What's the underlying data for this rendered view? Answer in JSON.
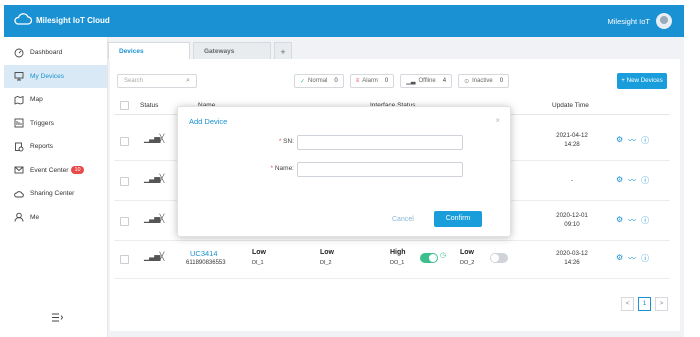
{
  "app": {
    "title": "Milesight IoT Cloud",
    "user": "Milesight IoT"
  },
  "sidebar": {
    "items": [
      {
        "label": "Dashboard",
        "icon": "dashboard-icon"
      },
      {
        "label": "My Devices",
        "icon": "devices-icon",
        "active": true
      },
      {
        "label": "Map",
        "icon": "map-icon"
      },
      {
        "label": "Triggers",
        "icon": "triggers-icon"
      },
      {
        "label": "Reports",
        "icon": "reports-icon"
      },
      {
        "label": "Event Center",
        "icon": "mail-icon",
        "badge": "10"
      },
      {
        "label": "Sharing Center",
        "icon": "cloud-share-icon"
      },
      {
        "label": "Me",
        "icon": "user-icon"
      }
    ]
  },
  "tabs": [
    {
      "label": "Devices"
    },
    {
      "label": "Gateways"
    },
    {
      "label": "+"
    }
  ],
  "toolbar": {
    "search_placeholder": "Search",
    "filters": [
      {
        "label": "Normal",
        "count": "0"
      },
      {
        "label": "Alarm",
        "count": "0"
      },
      {
        "label": "Offline",
        "count": "4"
      },
      {
        "label": "Inactive",
        "count": "0"
      }
    ],
    "new_button": "+ New Devices"
  },
  "table": {
    "headers": {
      "status": "Status",
      "name": "Name",
      "interface": "Interface Status",
      "update": "Update Time"
    },
    "rows": [
      {
        "update_date": "2021-04-12",
        "update_time": "14:28"
      },
      {
        "update_date": "-",
        "update_time": ""
      },
      {
        "update_date": "2020-12-01",
        "update_time": "09:10"
      },
      {
        "name": "UC3414",
        "sn": "611890836553",
        "di1": "Low",
        "di1_label": "DI_1",
        "di2": "Low",
        "di2_label": "DI_2",
        "do1": "High",
        "do1_label": "DO_1",
        "do1_on": true,
        "do2": "Low",
        "do2_label": "DO_2",
        "do2_on": false,
        "update_date": "2020-03-12",
        "update_time": "14:26"
      }
    ]
  },
  "pagination": {
    "prev": "<",
    "current": "1",
    "next": ">"
  },
  "modal": {
    "title": "Add Device",
    "close": "×",
    "sn_label": "SN:",
    "name_label": "Name:",
    "required_mark": "*",
    "cancel": "Cancel",
    "confirm": "Confirm"
  }
}
